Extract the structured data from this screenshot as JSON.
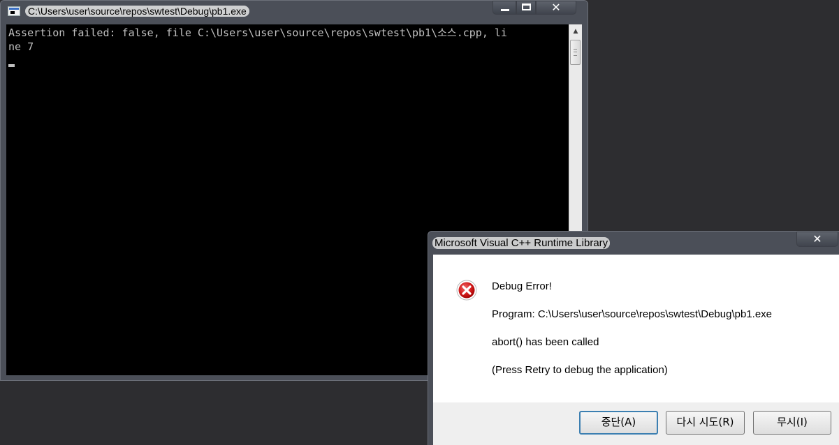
{
  "console": {
    "title": "C:\\Users\\user\\source\\repos\\swtest\\Debug\\pb1.exe",
    "output": "Assertion failed: false, file C:\\Users\\user\\source\\repos\\swtest\\pb1\\소스.cpp, li\nne 7",
    "background": "#000000",
    "text_color": "#c0c0c0"
  },
  "dialog": {
    "title": "Microsoft Visual C++ Runtime Library",
    "heading": "Debug Error!",
    "program_line": "Program: C:\\Users\\user\\source\\repos\\swtest\\Debug\\pb1.exe",
    "message": "abort() has been called",
    "hint": "(Press Retry to debug the application)",
    "icon": "error-icon",
    "buttons": {
      "abort": "중단(A)",
      "retry": "다시 시도(R)",
      "ignore": "무시(I)"
    }
  }
}
